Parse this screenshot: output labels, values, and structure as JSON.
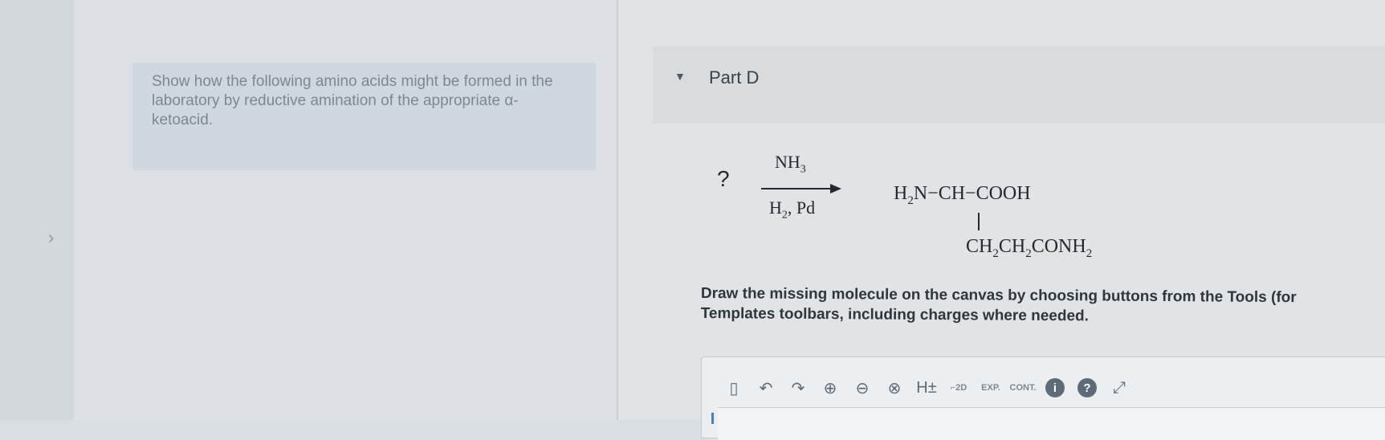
{
  "left": {
    "intro_text": "Show how the following amino acids might be formed in the laboratory by reductive amination of the appropriate α-ketoacid."
  },
  "part": {
    "label": "Part D"
  },
  "reaction": {
    "missing": "?",
    "reagent_top": "NH3",
    "reagent_bottom": "H2, Pd",
    "product_main": "H2N−CH−COOH",
    "product_side": "CH2CH2CONH2"
  },
  "instruction": {
    "line1": "Draw the missing molecule on the canvas by choosing buttons from the Tools (for",
    "line2": "Templates toolbars, including charges where needed."
  },
  "toolbar": {
    "h_label": "H±",
    "exp_label": "EXP.",
    "cont_label": "CONT.",
    "info_label": "i",
    "help_label": "?"
  }
}
